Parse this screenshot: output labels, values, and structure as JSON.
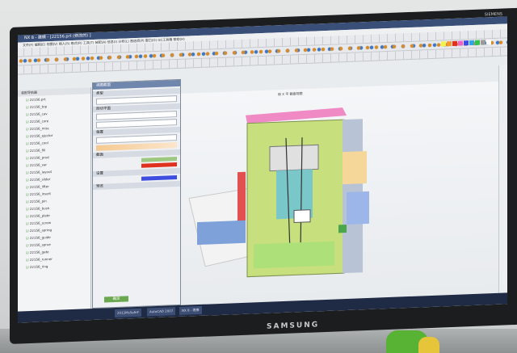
{
  "window": {
    "title": "NX 8 - 建模 - [22156.prt (修改的) ]"
  },
  "monitor": {
    "brand": "SAMSUNG",
    "maker_tag": "SIEMENS"
  },
  "menubar": {
    "text": "文件(F)  编辑(E)  视图(V)  插入(S)  格式(R)  工具(T)  装配(A)  信息(I)  分析(L)  首选项(P)  窗口(O)  GC工具箱  帮助(H)"
  },
  "navigator": {
    "title": "装配导航器",
    "items": [
      "22156.prt",
      "22156_top",
      "22156_cav",
      "22156_core",
      "22156_misc",
      "22156_ejector",
      "22156_cool",
      "22156_fill",
      "22156_prod",
      "22156_var",
      "22156_layout",
      "22156_slider",
      "22156_lifter",
      "22156_insert",
      "22156_pin",
      "22156_bush",
      "22156_plate",
      "22156_screw",
      "22156_spring",
      "22156_guide",
      "22156_sprue",
      "22156_gate",
      "22156_runner",
      "22156_ring"
    ]
  },
  "dialog": {
    "title": "视图截面",
    "sections": [
      "类型",
      "剖切平面",
      "偏置",
      "截面",
      "设置",
      "预览"
    ],
    "ok_label": "确定"
  },
  "graphics": {
    "view_label": "俯 X 平 截面视图"
  },
  "taskbar": {
    "items": [
      "2012MsSafeF",
      "AutoCAD 2007",
      "NX 8 - 建模"
    ]
  },
  "colors": {
    "palette": [
      "#f2f24b",
      "#f59a2b",
      "#e0301e",
      "#f062c8",
      "#3c4de0",
      "#2aa8e8",
      "#34c24a",
      "#9b9b9b",
      "#ffffff"
    ]
  }
}
